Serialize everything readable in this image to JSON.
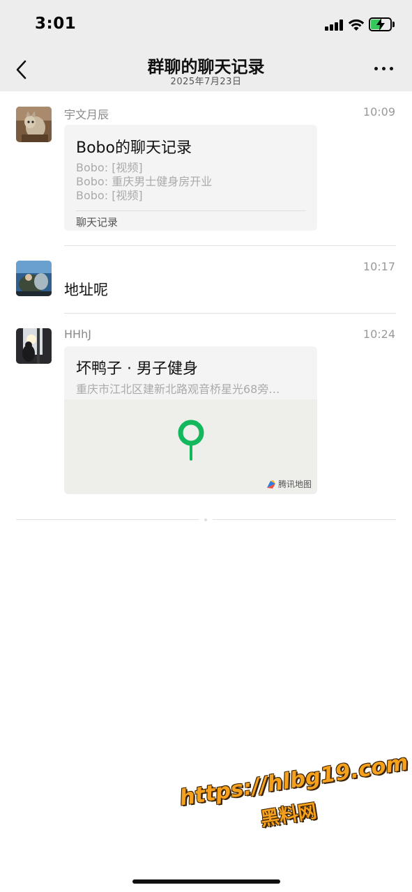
{
  "status_bar": {
    "time": "3:01"
  },
  "nav": {
    "title": "群聊的聊天记录",
    "subtitle": "2025年7月23日"
  },
  "messages": [
    {
      "sender": "宇文月辰",
      "time": "10:09",
      "card": {
        "title": "Bobo的聊天记录",
        "lines": [
          "Bobo: [视频]",
          "Bobo: 重庆男士健身房开业",
          "Bobo: [视频]"
        ],
        "footer": "聊天记录"
      }
    },
    {
      "sender": "",
      "time": "10:17",
      "text": "地址呢"
    },
    {
      "sender": "HHhJ",
      "time": "10:24",
      "location": {
        "name": "坏鸭子 · 男子健身",
        "address": "重庆市江北区建新北路观音桥星光68旁…",
        "map_credit": "腾讯地图"
      }
    }
  ],
  "watermark": {
    "url": "https://hlbg19.com",
    "label": "黑料网"
  },
  "colors": {
    "pin": "#14b85c",
    "watermark": "#f6a11d",
    "battery": "#34c759"
  }
}
